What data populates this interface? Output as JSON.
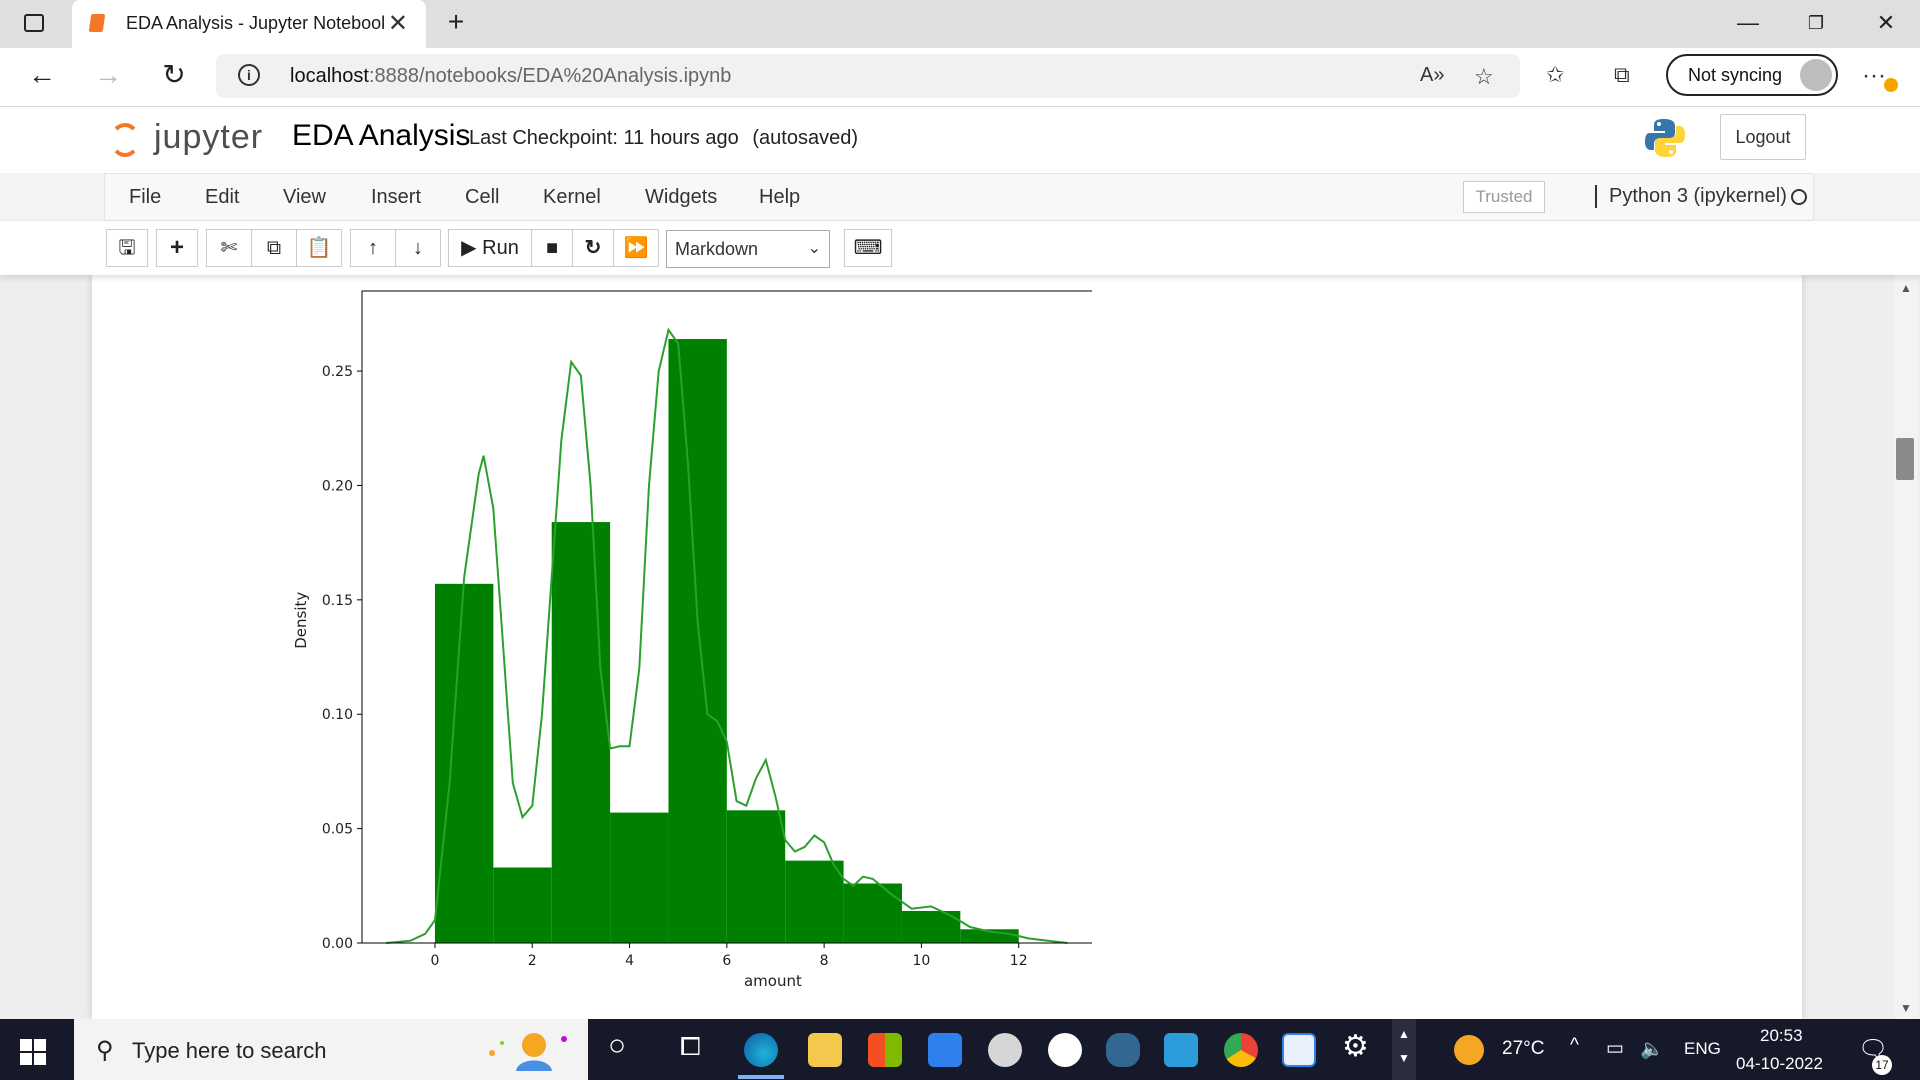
{
  "browser": {
    "tab_title": "EDA Analysis - Jupyter Notebook",
    "url_host": "localhost",
    "url_path": ":8888/notebooks/EDA%20Analysis.ipynb",
    "sync_label": "Not syncing",
    "icons": [
      "tab-actions-icon",
      "back-icon",
      "forward-icon",
      "refresh-icon",
      "info-icon",
      "read-aloud-icon",
      "add-favorite-icon",
      "favorites-icon",
      "collections-icon",
      "more-icon"
    ]
  },
  "jupyter": {
    "logo_text": "jupyter",
    "notebook_name": "EDA Analysis",
    "checkpoint": "Last Checkpoint: 11 hours ago",
    "autosaved": "(autosaved)",
    "logout_label": "Logout",
    "menu": [
      "File",
      "Edit",
      "View",
      "Insert",
      "Cell",
      "Kernel",
      "Widgets",
      "Help"
    ],
    "trusted_label": "Trusted",
    "kernel_label": "Python 3 (ipykernel)",
    "run_label": "Run",
    "cell_type": "Markdown"
  },
  "chart_data": {
    "type": "bar",
    "xlabel": "amount",
    "ylabel": "Density",
    "xlim": [
      -1.5,
      14
    ],
    "ylim": [
      0,
      0.285
    ],
    "xticks": [
      "0",
      "2",
      "4",
      "6",
      "8",
      "10",
      "12"
    ],
    "yticks": [
      "0.00",
      "0.05",
      "0.10",
      "0.15",
      "0.20",
      "0.25"
    ],
    "bar_color": "#008000",
    "kde_color": "#2ca02c",
    "bins": [
      {
        "x0": 0.0,
        "x1": 1.2,
        "density": 0.157
      },
      {
        "x0": 1.2,
        "x1": 2.4,
        "density": 0.033
      },
      {
        "x0": 2.4,
        "x1": 3.6,
        "density": 0.184
      },
      {
        "x0": 3.6,
        "x1": 4.8,
        "density": 0.057
      },
      {
        "x0": 4.8,
        "x1": 6.0,
        "density": 0.264
      },
      {
        "x0": 6.0,
        "x1": 7.2,
        "density": 0.058
      },
      {
        "x0": 7.2,
        "x1": 8.4,
        "density": 0.036
      },
      {
        "x0": 8.4,
        "x1": 9.6,
        "density": 0.026
      },
      {
        "x0": 9.6,
        "x1": 10.8,
        "density": 0.014
      },
      {
        "x0": 10.8,
        "x1": 12.0,
        "density": 0.006
      }
    ],
    "kde": {
      "x": [
        -1.0,
        -0.5,
        -0.2,
        0.0,
        0.3,
        0.6,
        0.9,
        1.0,
        1.2,
        1.4,
        1.6,
        1.8,
        2.0,
        2.2,
        2.4,
        2.6,
        2.8,
        3.0,
        3.2,
        3.4,
        3.6,
        3.8,
        4.0,
        4.2,
        4.4,
        4.6,
        4.8,
        5.0,
        5.2,
        5.4,
        5.6,
        5.8,
        6.0,
        6.2,
        6.4,
        6.6,
        6.8,
        7.0,
        7.2,
        7.4,
        7.6,
        7.8,
        8.0,
        8.2,
        8.4,
        8.6,
        8.8,
        9.0,
        9.4,
        9.8,
        10.2,
        10.6,
        11.0,
        11.4,
        11.8,
        12.2,
        12.6,
        13.0
      ],
      "y": [
        0.0,
        0.001,
        0.004,
        0.01,
        0.07,
        0.16,
        0.205,
        0.213,
        0.19,
        0.13,
        0.07,
        0.055,
        0.06,
        0.1,
        0.16,
        0.22,
        0.254,
        0.248,
        0.2,
        0.12,
        0.085,
        0.086,
        0.086,
        0.12,
        0.2,
        0.25,
        0.268,
        0.262,
        0.21,
        0.14,
        0.1,
        0.097,
        0.088,
        0.062,
        0.06,
        0.072,
        0.08,
        0.064,
        0.045,
        0.04,
        0.042,
        0.047,
        0.044,
        0.034,
        0.028,
        0.025,
        0.029,
        0.028,
        0.021,
        0.015,
        0.016,
        0.012,
        0.007,
        0.005,
        0.004,
        0.002,
        0.001,
        0.0
      ]
    }
  },
  "taskbar": {
    "search_placeholder": "Type here to search",
    "weather": "27°C",
    "language": "ENG",
    "time": "20:53",
    "date": "04-10-2022",
    "notification_count": "17"
  }
}
